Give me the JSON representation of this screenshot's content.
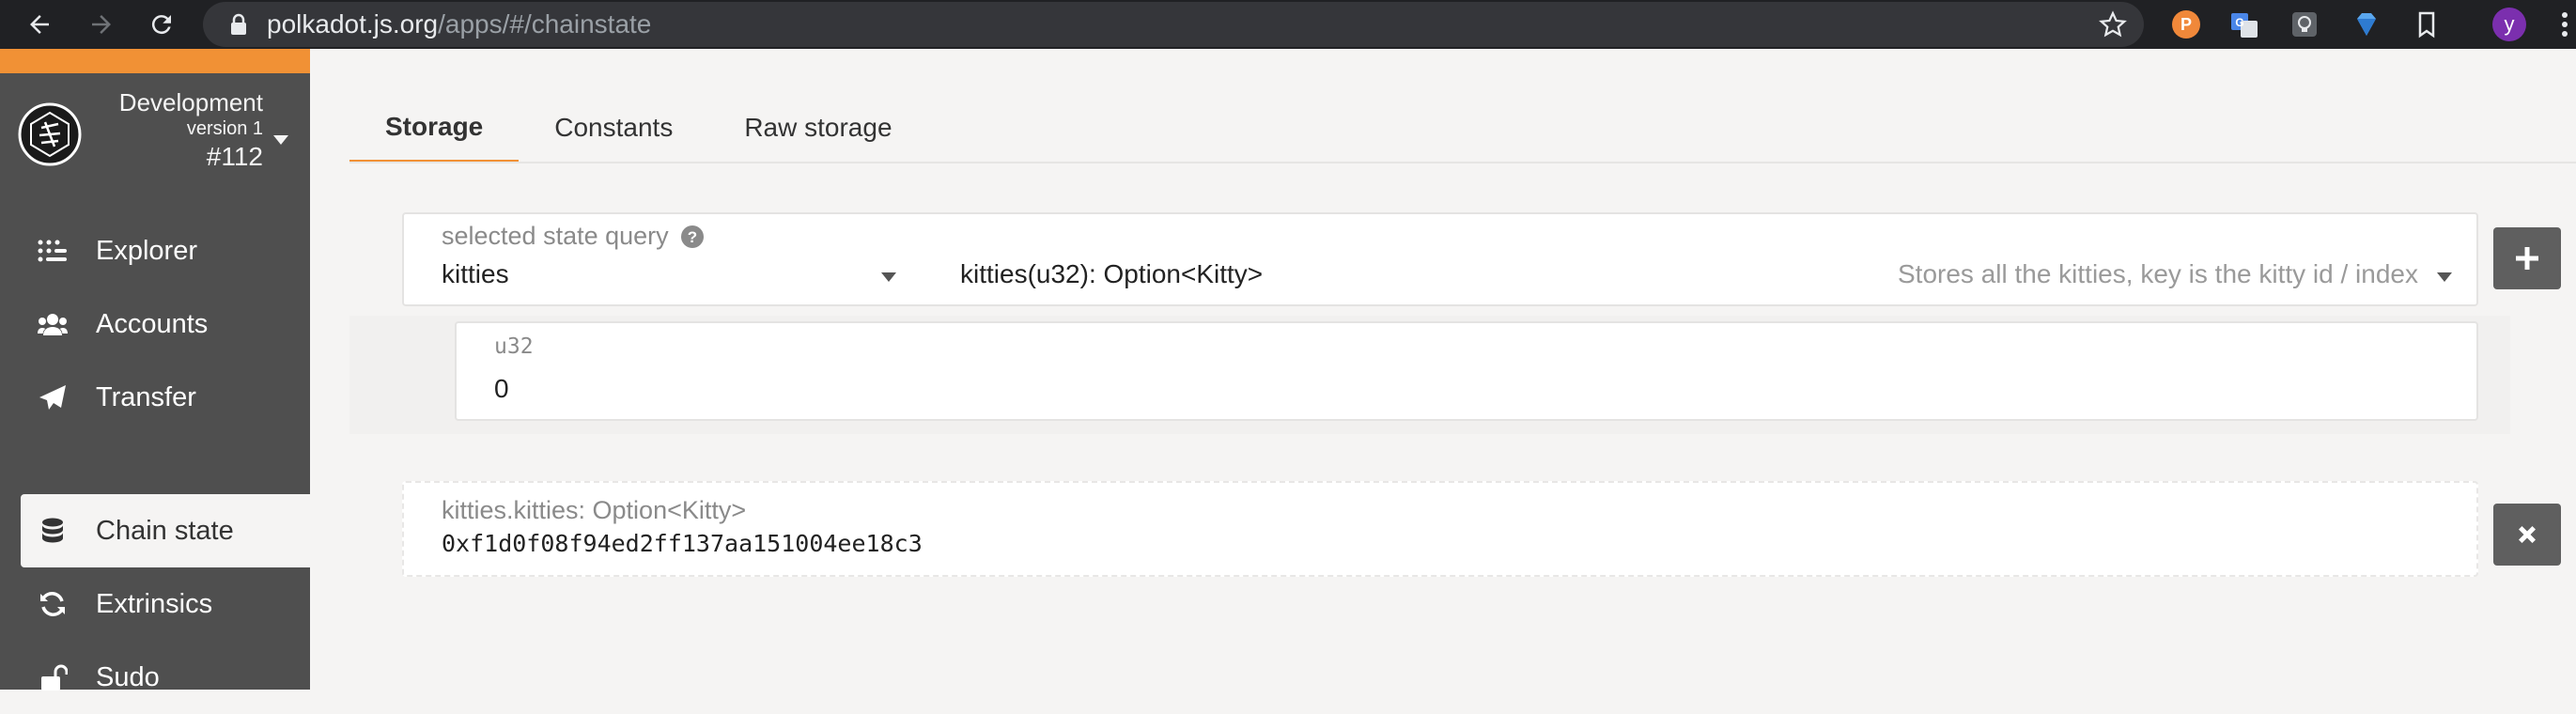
{
  "browser": {
    "url_host": "polkadot.js.org",
    "url_path": "/apps/#/chainstate",
    "profile_initial": "y"
  },
  "chain": {
    "name": "Development",
    "version": "version 1",
    "block": "#112"
  },
  "sidebar": {
    "items": [
      {
        "label": "Explorer",
        "icon": "explorer-icon"
      },
      {
        "label": "Accounts",
        "icon": "accounts-icon"
      },
      {
        "label": "Transfer",
        "icon": "paper-plane-icon"
      },
      {
        "label": "Chain state",
        "icon": "database-icon",
        "active": true
      },
      {
        "label": "Extrinsics",
        "icon": "sync-icon"
      },
      {
        "label": "Sudo",
        "icon": "unlock-icon"
      }
    ]
  },
  "tabs": [
    {
      "label": "Storage",
      "active": true
    },
    {
      "label": "Constants"
    },
    {
      "label": "Raw storage"
    }
  ],
  "query": {
    "label": "selected state query",
    "section": "kitties",
    "method": "kitties(u32): Option<Kitty>",
    "doc": "Stores all the kitties, key is the kitty id / index"
  },
  "param": {
    "type_label": "u32",
    "value": "0"
  },
  "result": {
    "label": "kitties.kitties: Option<Kitty>",
    "value": "0xf1d0f08f94ed2ff137aa151004ee18c3"
  },
  "colors": {
    "accent": "#f19135",
    "sidebar": "#4f4f4f",
    "button": "#5f5f5f"
  }
}
